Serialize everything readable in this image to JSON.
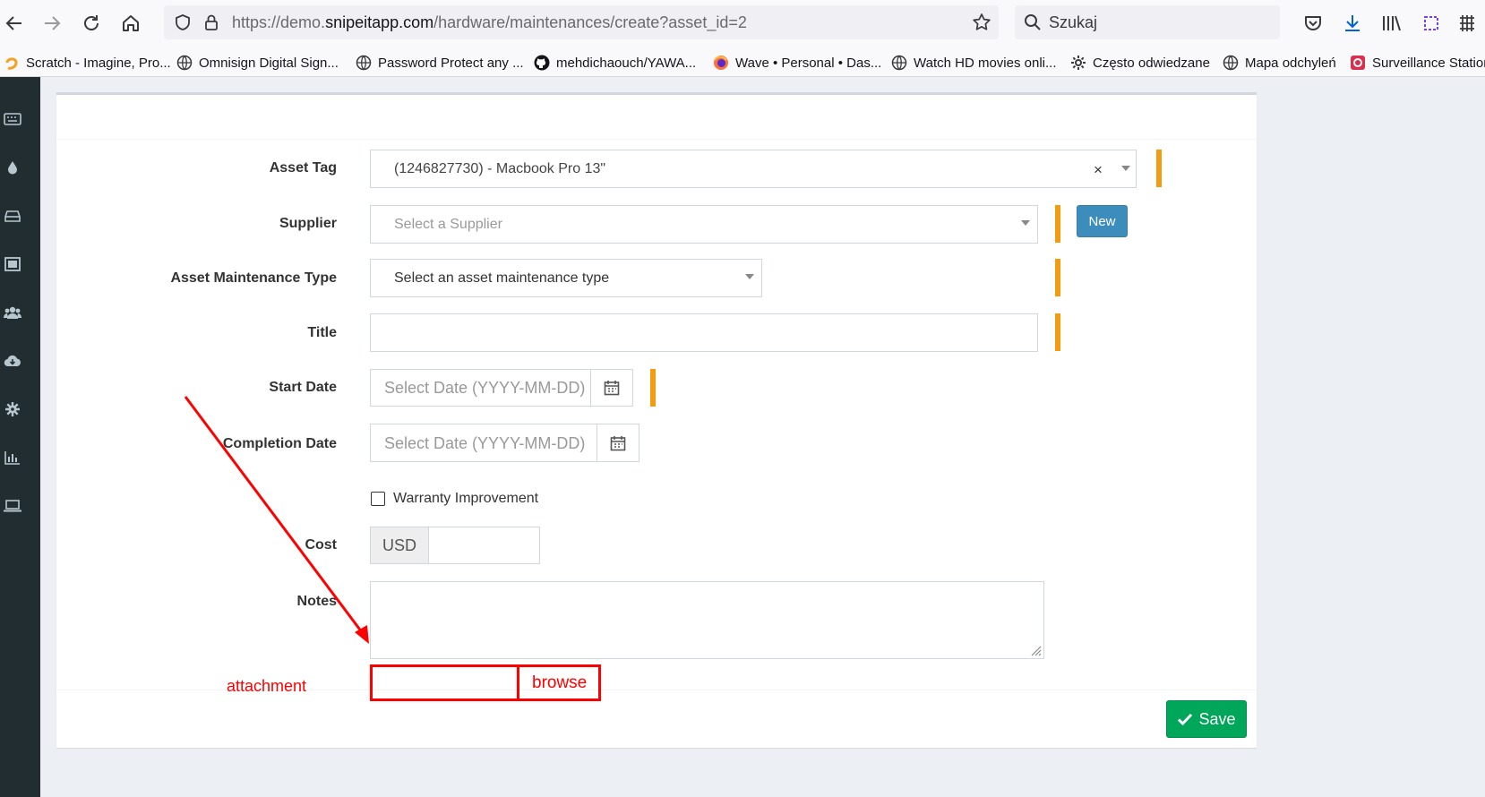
{
  "browser": {
    "url_prefix": "https://demo.",
    "url_host": "snipeitapp.com",
    "url_path": "/hardware/maintenances/create?asset_id=2",
    "search_placeholder": "Szukaj",
    "bookmarks": [
      "Scratch - Imagine, Pro...",
      "Omnisign Digital Sign...",
      "Password Protect any ...",
      "mehdichaouch/YAWA...",
      "Wave • Personal • Das...",
      "Watch HD movies onli...",
      "Często odwiedzane",
      "Mapa odchyleń",
      "Surveillance Station"
    ]
  },
  "form": {
    "asset_tag": {
      "label": "Asset Tag",
      "value": "(1246827730) - Macbook Pro 13\"",
      "clear": "×"
    },
    "supplier": {
      "label": "Supplier",
      "placeholder": "Select a Supplier",
      "new_button": "New"
    },
    "maintenance_type": {
      "label": "Asset Maintenance Type",
      "value": "Select an asset maintenance type"
    },
    "title": {
      "label": "Title",
      "value": ""
    },
    "start_date": {
      "label": "Start Date",
      "placeholder": "Select Date (YYYY-MM-DD)"
    },
    "completion_date": {
      "label": "Completion Date",
      "placeholder": "Select Date (YYYY-MM-DD)"
    },
    "warranty": {
      "label": "Warranty Improvement",
      "checked": false
    },
    "cost": {
      "label": "Cost",
      "currency": "USD",
      "value": ""
    },
    "notes": {
      "label": "Notes",
      "value": ""
    },
    "save_button": "Save"
  },
  "annotation": {
    "attachment_label": "attachment",
    "browse_label": "browse",
    "color": "#ff0000"
  },
  "colors": {
    "required_marker": "#f39c12",
    "primary": "#3c8dbc",
    "success": "#00a65a",
    "sidebar": "#222d32"
  }
}
